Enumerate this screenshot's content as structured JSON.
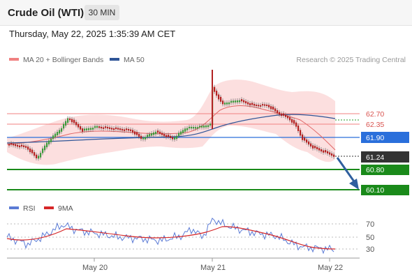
{
  "header": {
    "title": "Crude Oil (WTI)",
    "timeframe": "30 MIN"
  },
  "timestamp": "Thursday, May 22, 2025 1:35:39 AM CET",
  "legend": {
    "bollinger": {
      "label": "MA 20 + Bollinger Bands",
      "color": "#f08080"
    },
    "ma50": {
      "label": "MA 50",
      "color": "#2f5597"
    }
  },
  "copyright": "Research © 2025 Trading Central",
  "levels": {
    "resist2": "62.70",
    "resist1": "62.35",
    "pivot": "61.90",
    "last": "61.24",
    "support1": "60.80",
    "support2": "60.10"
  },
  "rsi": {
    "legend_rsi": "RSI",
    "legend_ma": "9MA",
    "rsi_color": "#5b7bd5",
    "ma_color": "#d62728",
    "ticks": [
      "70",
      "50",
      "30"
    ]
  },
  "xaxis": {
    "labels": [
      "May 20",
      "May 21",
      "May 22"
    ]
  },
  "colors": {
    "up": "#3c9a3c",
    "down": "#b22222",
    "pivot": "#2a6fdb",
    "support": "#1a8a1a",
    "resistance": "#f08080",
    "last": "#333333"
  }
}
